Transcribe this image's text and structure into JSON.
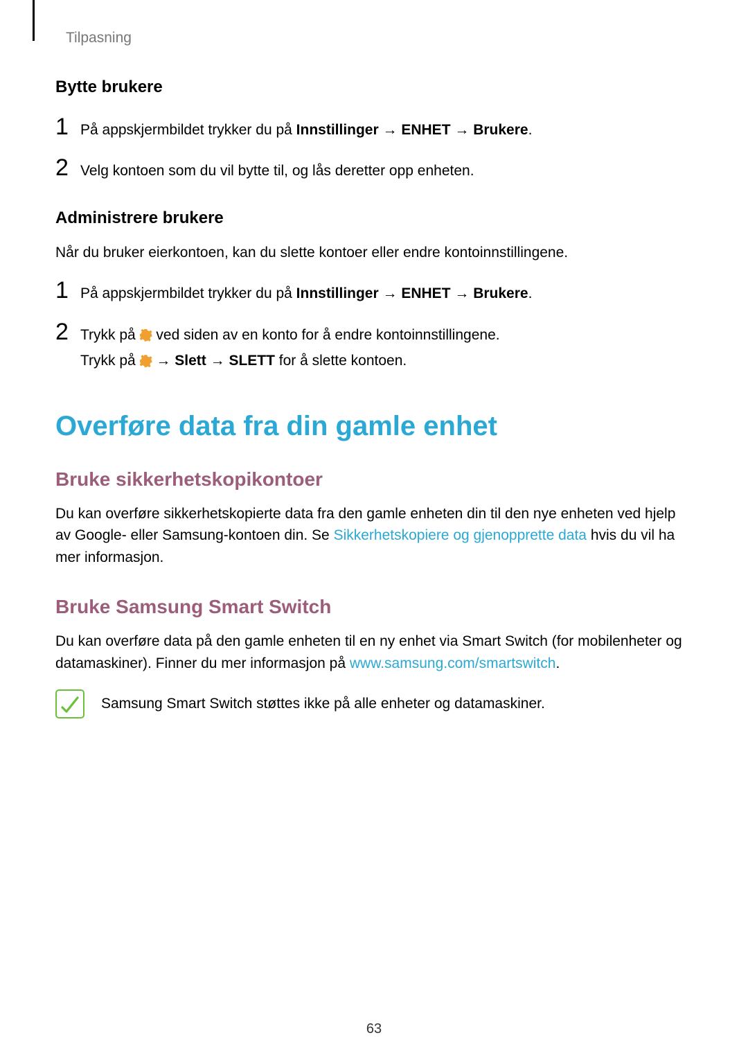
{
  "labels": {
    "section": "Tilpasning",
    "bytte_brukere": "Bytte brukere",
    "admin_brukere": "Administrere brukere",
    "h1": "Overføre data fra din gamle enhet",
    "h2a": "Bruke sikkerhetskopikontoer",
    "h2b": "Bruke Samsung Smart Switch"
  },
  "step1_1": {
    "num": "1",
    "pre": "På appskjermbildet trykker du på ",
    "b1": "Innstillinger",
    "arr1": " → ",
    "b2": "ENHET",
    "arr2": " → ",
    "b3": "Brukere",
    "post": "."
  },
  "step1_2": {
    "num": "2",
    "text": "Velg kontoen som du vil bytte til, og lås deretter opp enheten."
  },
  "admin_intro": "Når du bruker eierkontoen, kan du slette kontoer eller endre kontoinnstillingene.",
  "step2_1": {
    "num": "1",
    "pre": "På appskjermbildet trykker du på ",
    "b1": "Innstillinger",
    "arr1": " → ",
    "b2": "ENHET",
    "arr2": " → ",
    "b3": "Brukere",
    "post": "."
  },
  "step2_2": {
    "num": "2",
    "pre": "Trykk på ",
    "post": " ved siden av en konto for å endre kontoinnstillingene.",
    "sub_pre": "Trykk på ",
    "sub_arr1": " → ",
    "sub_b1": "Slett",
    "sub_arr2": " → ",
    "sub_b2": "SLETT",
    "sub_post": " for å slette kontoen."
  },
  "sect_a": {
    "pre": "Du kan overføre sikkerhetskopierte data fra den gamle enheten din til den nye enheten ved hjelp av Google- eller Samsung-kontoen din. Se ",
    "link": "Sikkerhetskopiere og gjenopprette data",
    "post": " hvis du vil ha mer informasjon."
  },
  "sect_b": {
    "pre": "Du kan overføre data på den gamle enheten til en ny enhet via Smart Switch (for mobilenheter og datamaskiner). Finner du mer informasjon på ",
    "link": "www.samsung.com/smartswitch",
    "post": "."
  },
  "note": "Samsung Smart Switch støttes ikke på alle enheter og datamaskiner.",
  "pagenum": "63"
}
